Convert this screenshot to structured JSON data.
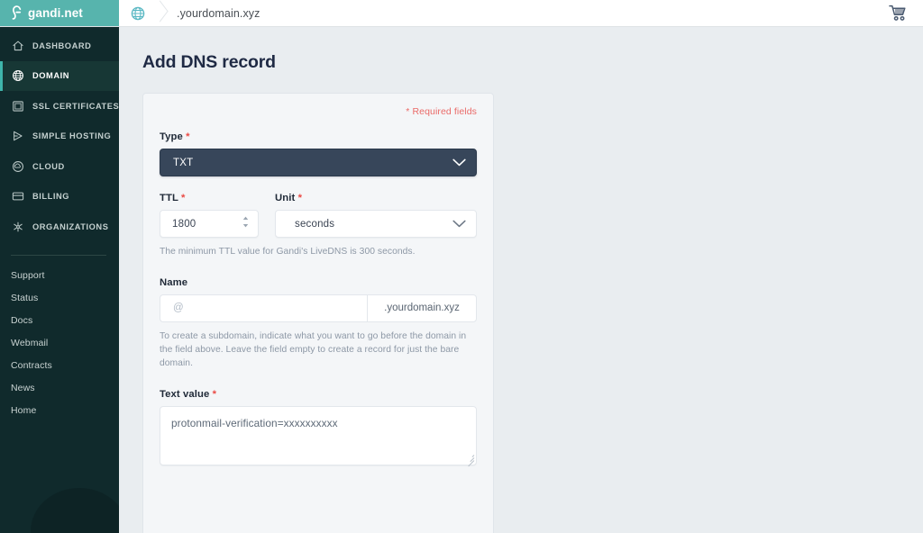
{
  "brand": {
    "logo_text": "gandi.net",
    "logo_bg": "#57b4ad",
    "accent_teal": "#3fb5ab",
    "sidebar_bg": "#102a2c",
    "required_red": "#ea4a44"
  },
  "topbar": {
    "breadcrumb_domain": ".yourdomain.xyz",
    "globe_icon": "globe-icon",
    "cart_icon": "shopping-cart-icon"
  },
  "sidebar": {
    "items": [
      {
        "label": "DASHBOARD",
        "icon": "home-icon",
        "active": false
      },
      {
        "label": "DOMAIN",
        "icon": "globe-icon",
        "active": true
      },
      {
        "label": "SSL CERTIFICATES",
        "icon": "certificate-icon",
        "active": false
      },
      {
        "label": "SIMPLE HOSTING",
        "icon": "play-icon",
        "active": false
      },
      {
        "label": "CLOUD",
        "icon": "cloud-circle-icon",
        "active": false
      },
      {
        "label": "BILLING",
        "icon": "credit-card-icon",
        "active": false
      },
      {
        "label": "ORGANIZATIONS",
        "icon": "organizations-icon",
        "active": false
      }
    ],
    "links": [
      {
        "label": "Support"
      },
      {
        "label": "Status"
      },
      {
        "label": "Docs"
      },
      {
        "label": "Webmail"
      },
      {
        "label": "Contracts"
      },
      {
        "label": "News"
      },
      {
        "label": "Home"
      }
    ]
  },
  "main": {
    "page_title": "Add DNS record",
    "required_note": "* Required fields",
    "form": {
      "type": {
        "label": "Type",
        "required": true,
        "value": "TXT",
        "chevron_icon": "chevron-down-icon"
      },
      "ttl": {
        "label": "TTL",
        "required": true,
        "value": "1800",
        "spinner_icon": "number-spinner-icon"
      },
      "unit": {
        "label": "Unit",
        "required": true,
        "value": "seconds",
        "chevron_icon": "chevron-down-icon"
      },
      "ttl_helper": "The minimum TTL value for Gandi's LiveDNS is 300 seconds.",
      "name": {
        "label": "Name",
        "required": false,
        "value": "",
        "placeholder": "@",
        "suffix": ".yourdomain.xyz"
      },
      "name_helper": "To create a subdomain, indicate what you want to go before the domain in the field above. Leave the field empty to create a record for just the bare domain.",
      "text_value": {
        "label": "Text value",
        "required": true,
        "value": "protonmail-verification=xxxxxxxxxx",
        "resize_icon": "resize-grip-icon"
      }
    }
  }
}
